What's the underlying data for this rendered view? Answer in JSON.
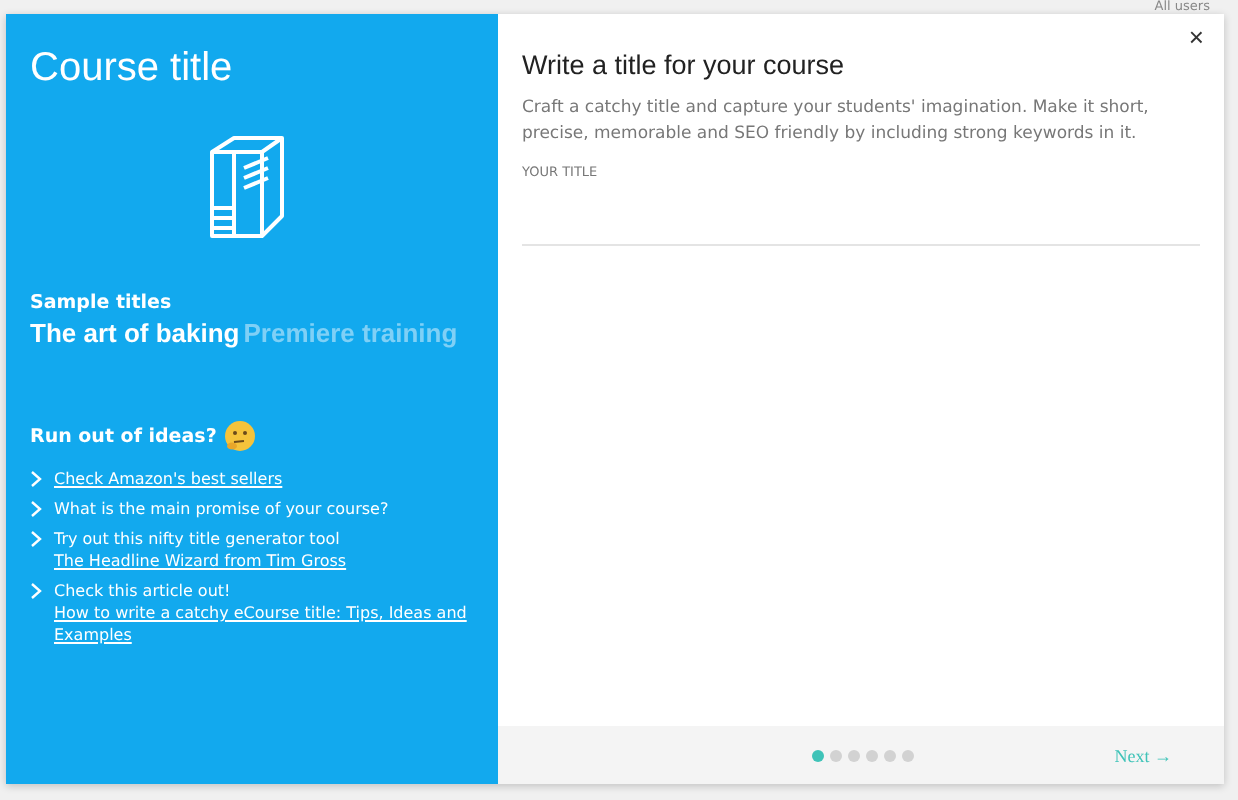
{
  "backdrop": {
    "label": "All users"
  },
  "left_panel": {
    "title": "Course title",
    "sample_titles": {
      "heading": "Sample titles",
      "items": [
        {
          "text": "The art of baking",
          "selected": true
        },
        {
          "text": "Premiere training",
          "selected": false
        }
      ]
    },
    "ideas": {
      "heading": "Run out of ideas?",
      "items": [
        {
          "link": "Check Amazon's best sellers"
        },
        {
          "text": "What is the main promise of your course?"
        },
        {
          "text": "Try out this nifty title generator tool",
          "link": "The Headline Wizard from Tim Gross"
        },
        {
          "text": "Check this article out!",
          "link": "How to write a catchy eCourse title: Tips, Ideas and Examples"
        }
      ]
    }
  },
  "right_panel": {
    "close": "×",
    "heading": "Write a title for your course",
    "description": "Craft a catchy title and capture your students' imagination. Make it short, precise, memorable and SEO friendly by including strong keywords in it.",
    "field_label": "YOUR TITLE"
  },
  "footer": {
    "steps": [
      {
        "selected": true
      },
      {
        "selected": false
      },
      {
        "selected": false
      },
      {
        "selected": false
      },
      {
        "selected": false
      },
      {
        "selected": false
      }
    ],
    "next": "Next →"
  }
}
